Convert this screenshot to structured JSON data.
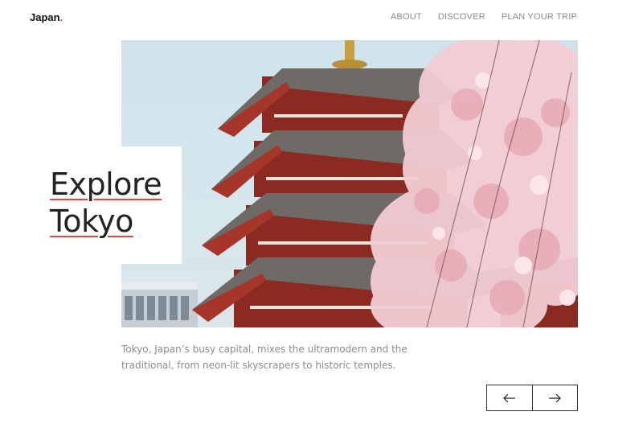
{
  "header": {
    "brand": "Japan",
    "brand_dot": ".",
    "nav": [
      "ABOUT",
      "DISCOVER",
      "PLAN YOUR TRIP"
    ]
  },
  "hero": {
    "headline_line1": "Explore",
    "headline_line2": "Tokyo",
    "description": "Tokyo, Japan’s busy capital, mixes the ultramodern and the traditional, from neon-lit skyscrapers to historic temples."
  },
  "controls": {
    "prev_icon": "arrow-left-icon",
    "next_icon": "arrow-right-icon"
  },
  "colors": {
    "accent": "#e04a3a",
    "pagoda_red": "#8b2a20",
    "blossom": "#f0c8cf",
    "sky": "#cfe3ec"
  }
}
